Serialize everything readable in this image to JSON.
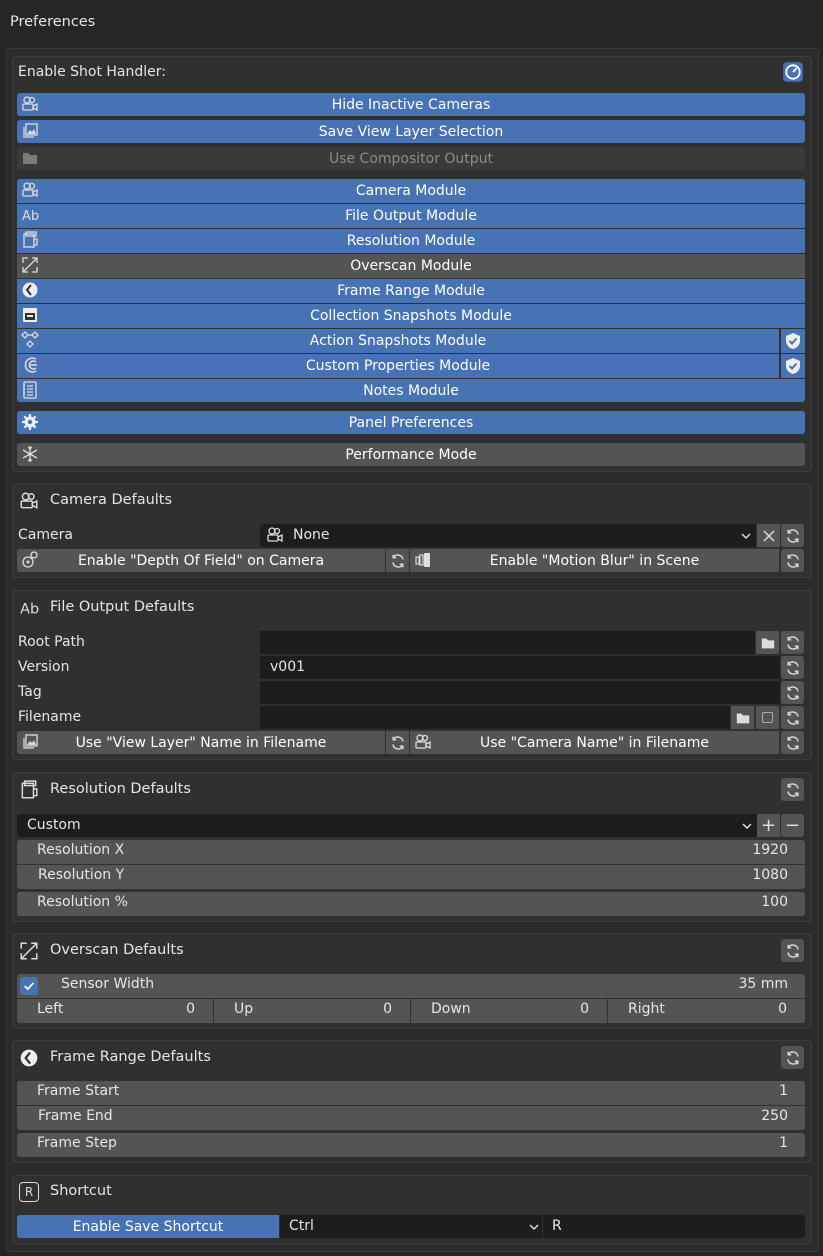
{
  "window": {
    "title": "Preferences"
  },
  "shot_handler": {
    "enable_label": "Enable Shot Handler:",
    "options": {
      "hide_inactive": "Hide Inactive Cameras",
      "save_view_layer": "Save View Layer Selection",
      "use_compositor": "Use Compositor Output"
    },
    "modules": {
      "camera": "Camera Module",
      "file_output": "File Output Module",
      "resolution": "Resolution Module",
      "overscan": "Overscan Module",
      "frame_range": "Frame Range Module",
      "collection_snapshots": "Collection Snapshots Module",
      "action_snapshots": "Action Snapshots Module",
      "custom_properties": "Custom Properties Module",
      "notes": "Notes Module"
    },
    "panel_prefs": "Panel Preferences",
    "performance_mode": "Performance Mode"
  },
  "camera_defaults": {
    "header": "Camera Defaults",
    "camera_label": "Camera",
    "camera_value": "None",
    "dof_button": "Enable \"Depth Of Field\" on Camera",
    "motion_blur_button": "Enable \"Motion Blur\" in Scene"
  },
  "file_output_defaults": {
    "header": "File Output Defaults",
    "root_path_label": "Root Path",
    "root_path_value": "",
    "version_label": "Version",
    "version_value": "v001",
    "tag_label": "Tag",
    "tag_value": "",
    "filename_label": "Filename",
    "filename_value": "",
    "view_layer_button": "Use \"View Layer\" Name in Filename",
    "camera_name_button": "Use \"Camera Name\" in Filename"
  },
  "resolution_defaults": {
    "header": "Resolution Defaults",
    "preset": "Custom",
    "res_x_label": "Resolution X",
    "res_x_value": "1920",
    "res_y_label": "Resolution Y",
    "res_y_value": "1080",
    "res_pct_label": "Resolution %",
    "res_pct_value": "100"
  },
  "overscan_defaults": {
    "header": "Overscan Defaults",
    "sensor_width_label": "Sensor Width",
    "sensor_width_value": "35 mm",
    "left_label": "Left",
    "left_value": "0",
    "up_label": "Up",
    "up_value": "0",
    "down_label": "Down",
    "down_value": "0",
    "right_label": "Right",
    "right_value": "0"
  },
  "frame_range_defaults": {
    "header": "Frame Range Defaults",
    "start_label": "Frame Start",
    "start_value": "1",
    "end_label": "Frame End",
    "end_value": "250",
    "step_label": "Frame Step",
    "step_value": "1"
  },
  "shortcut": {
    "header": "Shortcut",
    "header_icon_letter": "R",
    "enable_button": "Enable Save Shortcut",
    "modifier": "Ctrl",
    "key": "R"
  },
  "colors": {
    "accent": "#4772b3",
    "button": "#545454",
    "background": "#262626",
    "field": "#1d1d1d"
  }
}
